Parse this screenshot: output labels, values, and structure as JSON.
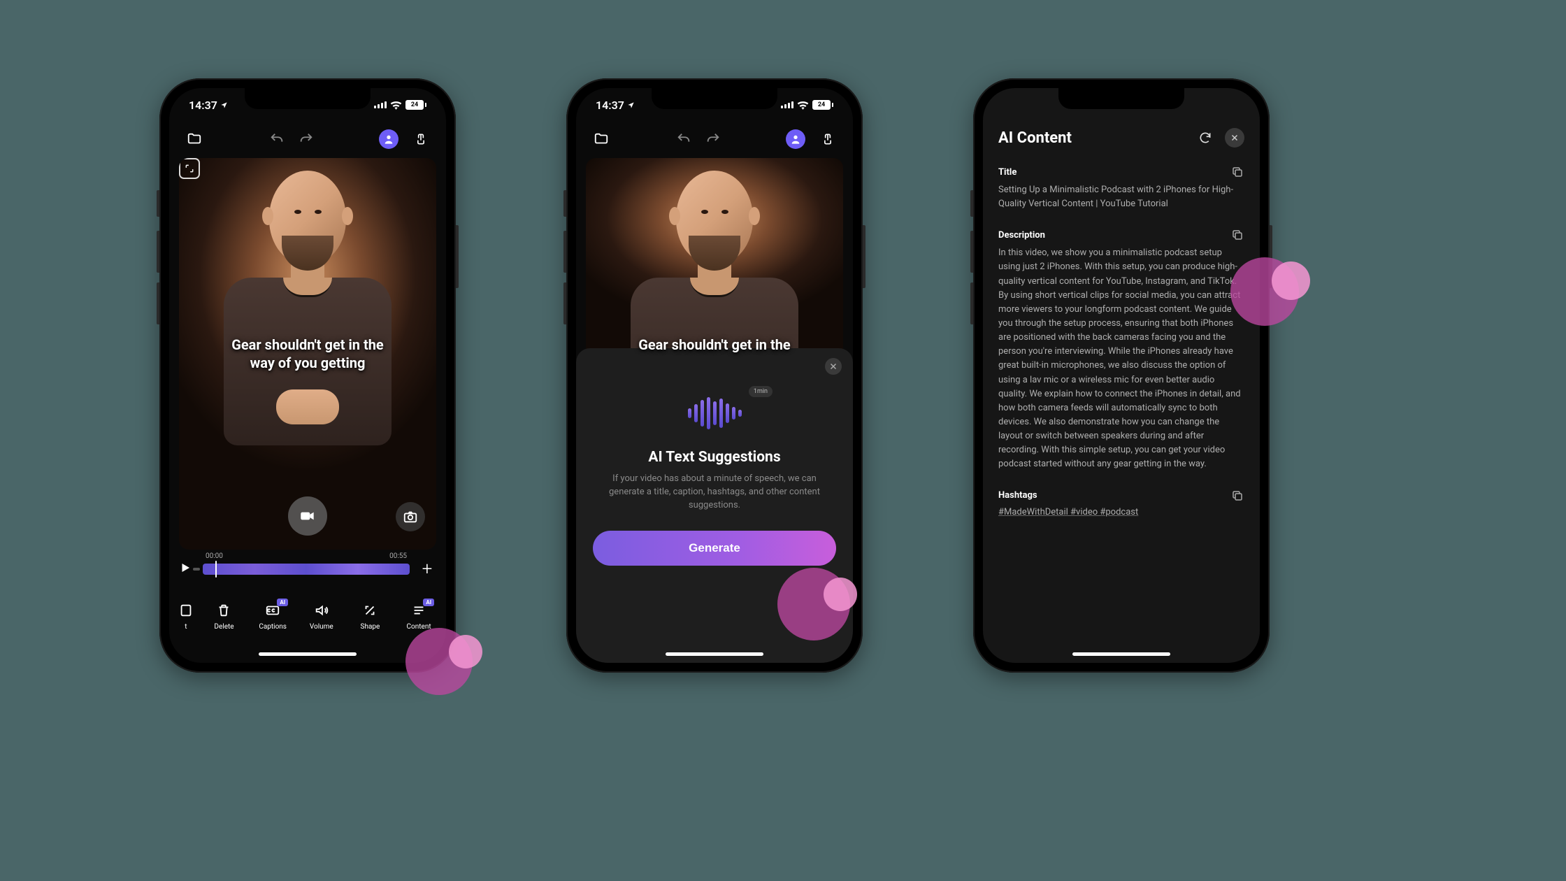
{
  "status": {
    "time": "14:37",
    "battery": "24"
  },
  "phone1": {
    "caption_l1": "Gear shouldn't get in the",
    "caption_l2": "way of you getting",
    "time_start": "00:00",
    "time_end": "00:55",
    "tools": {
      "cut": "t",
      "delete": "Delete",
      "captions": "Captions",
      "volume": "Volume",
      "shape": "Shape",
      "content": "Content",
      "badge": "AI"
    }
  },
  "phone2": {
    "caption_l1": "Gear shouldn't get in the",
    "bubble": "1min",
    "sheet_title": "AI Text Suggestions",
    "sheet_desc": "If your video has about a minute of speech, we can generate a title, caption, hashtags, and other content suggestions.",
    "generate": "Generate"
  },
  "phone3": {
    "header": "AI Content",
    "title_label": "Title",
    "title_text": "Setting Up a Minimalistic Podcast with 2 iPhones for High-Quality Vertical Content | YouTube Tutorial",
    "desc_label": "Description",
    "desc_text": "In this video, we show you a minimalistic podcast setup using just 2 iPhones. With this setup, you can produce high-quality vertical content for YouTube, Instagram, and TikTok. By using short vertical clips for social media, you can attract more viewers to your longform podcast content. We guide you through the setup process, ensuring that both iPhones are positioned with the back cameras facing you and the person you're interviewing. While the iPhones already have great built-in microphones, we also discuss the option of using a lav mic or a wireless mic for even better audio quality. We explain how to connect the iPhones in detail, and how both camera feeds will automatically sync to both devices. We also demonstrate how you can change the layout or switch between speakers during and after recording. With this simple setup, you can get your video podcast started without any gear getting in the way.",
    "hash_label": "Hashtags",
    "hash_text": "#MadeWithDetail #video #podcast"
  }
}
